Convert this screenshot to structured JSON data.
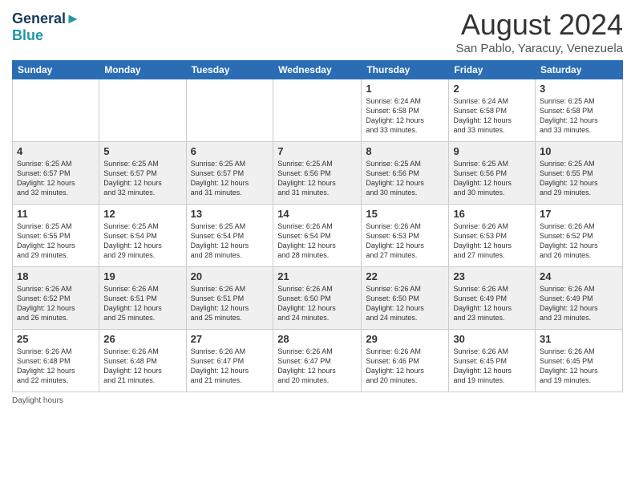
{
  "header": {
    "logo_line1": "General",
    "logo_line2": "Blue",
    "month_year": "August 2024",
    "location": "San Pablo, Yaracuy, Venezuela"
  },
  "days_of_week": [
    "Sunday",
    "Monday",
    "Tuesday",
    "Wednesday",
    "Thursday",
    "Friday",
    "Saturday"
  ],
  "weeks": [
    [
      {
        "day": "",
        "info": ""
      },
      {
        "day": "",
        "info": ""
      },
      {
        "day": "",
        "info": ""
      },
      {
        "day": "",
        "info": ""
      },
      {
        "day": "1",
        "info": "Sunrise: 6:24 AM\nSunset: 6:58 PM\nDaylight: 12 hours\nand 33 minutes."
      },
      {
        "day": "2",
        "info": "Sunrise: 6:24 AM\nSunset: 6:58 PM\nDaylight: 12 hours\nand 33 minutes."
      },
      {
        "day": "3",
        "info": "Sunrise: 6:25 AM\nSunset: 6:58 PM\nDaylight: 12 hours\nand 33 minutes."
      }
    ],
    [
      {
        "day": "4",
        "info": "Sunrise: 6:25 AM\nSunset: 6:57 PM\nDaylight: 12 hours\nand 32 minutes."
      },
      {
        "day": "5",
        "info": "Sunrise: 6:25 AM\nSunset: 6:57 PM\nDaylight: 12 hours\nand 32 minutes."
      },
      {
        "day": "6",
        "info": "Sunrise: 6:25 AM\nSunset: 6:57 PM\nDaylight: 12 hours\nand 31 minutes."
      },
      {
        "day": "7",
        "info": "Sunrise: 6:25 AM\nSunset: 6:56 PM\nDaylight: 12 hours\nand 31 minutes."
      },
      {
        "day": "8",
        "info": "Sunrise: 6:25 AM\nSunset: 6:56 PM\nDaylight: 12 hours\nand 30 minutes."
      },
      {
        "day": "9",
        "info": "Sunrise: 6:25 AM\nSunset: 6:56 PM\nDaylight: 12 hours\nand 30 minutes."
      },
      {
        "day": "10",
        "info": "Sunrise: 6:25 AM\nSunset: 6:55 PM\nDaylight: 12 hours\nand 29 minutes."
      }
    ],
    [
      {
        "day": "11",
        "info": "Sunrise: 6:25 AM\nSunset: 6:55 PM\nDaylight: 12 hours\nand 29 minutes."
      },
      {
        "day": "12",
        "info": "Sunrise: 6:25 AM\nSunset: 6:54 PM\nDaylight: 12 hours\nand 29 minutes."
      },
      {
        "day": "13",
        "info": "Sunrise: 6:25 AM\nSunset: 6:54 PM\nDaylight: 12 hours\nand 28 minutes."
      },
      {
        "day": "14",
        "info": "Sunrise: 6:26 AM\nSunset: 6:54 PM\nDaylight: 12 hours\nand 28 minutes."
      },
      {
        "day": "15",
        "info": "Sunrise: 6:26 AM\nSunset: 6:53 PM\nDaylight: 12 hours\nand 27 minutes."
      },
      {
        "day": "16",
        "info": "Sunrise: 6:26 AM\nSunset: 6:53 PM\nDaylight: 12 hours\nand 27 minutes."
      },
      {
        "day": "17",
        "info": "Sunrise: 6:26 AM\nSunset: 6:52 PM\nDaylight: 12 hours\nand 26 minutes."
      }
    ],
    [
      {
        "day": "18",
        "info": "Sunrise: 6:26 AM\nSunset: 6:52 PM\nDaylight: 12 hours\nand 26 minutes."
      },
      {
        "day": "19",
        "info": "Sunrise: 6:26 AM\nSunset: 6:51 PM\nDaylight: 12 hours\nand 25 minutes."
      },
      {
        "day": "20",
        "info": "Sunrise: 6:26 AM\nSunset: 6:51 PM\nDaylight: 12 hours\nand 25 minutes."
      },
      {
        "day": "21",
        "info": "Sunrise: 6:26 AM\nSunset: 6:50 PM\nDaylight: 12 hours\nand 24 minutes."
      },
      {
        "day": "22",
        "info": "Sunrise: 6:26 AM\nSunset: 6:50 PM\nDaylight: 12 hours\nand 24 minutes."
      },
      {
        "day": "23",
        "info": "Sunrise: 6:26 AM\nSunset: 6:49 PM\nDaylight: 12 hours\nand 23 minutes."
      },
      {
        "day": "24",
        "info": "Sunrise: 6:26 AM\nSunset: 6:49 PM\nDaylight: 12 hours\nand 23 minutes."
      }
    ],
    [
      {
        "day": "25",
        "info": "Sunrise: 6:26 AM\nSunset: 6:48 PM\nDaylight: 12 hours\nand 22 minutes."
      },
      {
        "day": "26",
        "info": "Sunrise: 6:26 AM\nSunset: 6:48 PM\nDaylight: 12 hours\nand 21 minutes."
      },
      {
        "day": "27",
        "info": "Sunrise: 6:26 AM\nSunset: 6:47 PM\nDaylight: 12 hours\nand 21 minutes."
      },
      {
        "day": "28",
        "info": "Sunrise: 6:26 AM\nSunset: 6:47 PM\nDaylight: 12 hours\nand 20 minutes."
      },
      {
        "day": "29",
        "info": "Sunrise: 6:26 AM\nSunset: 6:46 PM\nDaylight: 12 hours\nand 20 minutes."
      },
      {
        "day": "30",
        "info": "Sunrise: 6:26 AM\nSunset: 6:45 PM\nDaylight: 12 hours\nand 19 minutes."
      },
      {
        "day": "31",
        "info": "Sunrise: 6:26 AM\nSunset: 6:45 PM\nDaylight: 12 hours\nand 19 minutes."
      }
    ]
  ],
  "footer": {
    "daylight_label": "Daylight hours"
  }
}
